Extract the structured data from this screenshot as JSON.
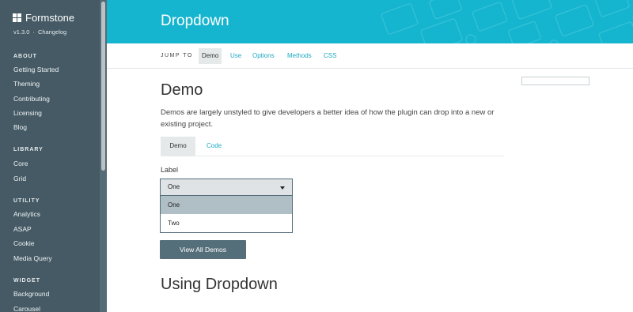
{
  "sidebar": {
    "brand": "Formstone",
    "version": "v1.3.0",
    "changelog": "Changelog",
    "separator": "·",
    "sections": [
      {
        "title": "ABOUT",
        "items": [
          "Getting Started",
          "Theming",
          "Contributing",
          "Licensing",
          "Blog"
        ]
      },
      {
        "title": "LIBRARY",
        "items": [
          "Core",
          "Grid"
        ]
      },
      {
        "title": "UTILITY",
        "items": [
          "Analytics",
          "ASAP",
          "Cookie",
          "Media Query"
        ]
      },
      {
        "title": "WIDGET",
        "items": [
          "Background",
          "Carousel"
        ]
      }
    ]
  },
  "header": {
    "title": "Dropdown"
  },
  "jump": {
    "label": "JUMP TO",
    "links": [
      "Demo",
      "Use",
      "Options",
      "Methods",
      "CSS"
    ]
  },
  "demo": {
    "heading": "Demo",
    "description": "Demos are largely unstyled to give developers a better idea of how the plugin can drop into a new or existing project.",
    "tabs": [
      "Demo",
      "Code"
    ],
    "field_label": "Label",
    "selected": "One",
    "options": [
      "One",
      "Two"
    ],
    "view_all": "View All Demos"
  },
  "using": {
    "heading": "Using Dropdown"
  },
  "colors": {
    "sidebar": "#455a64",
    "header": "#16b5cf",
    "accent": "#1ea7c2",
    "button": "#546e7a"
  }
}
